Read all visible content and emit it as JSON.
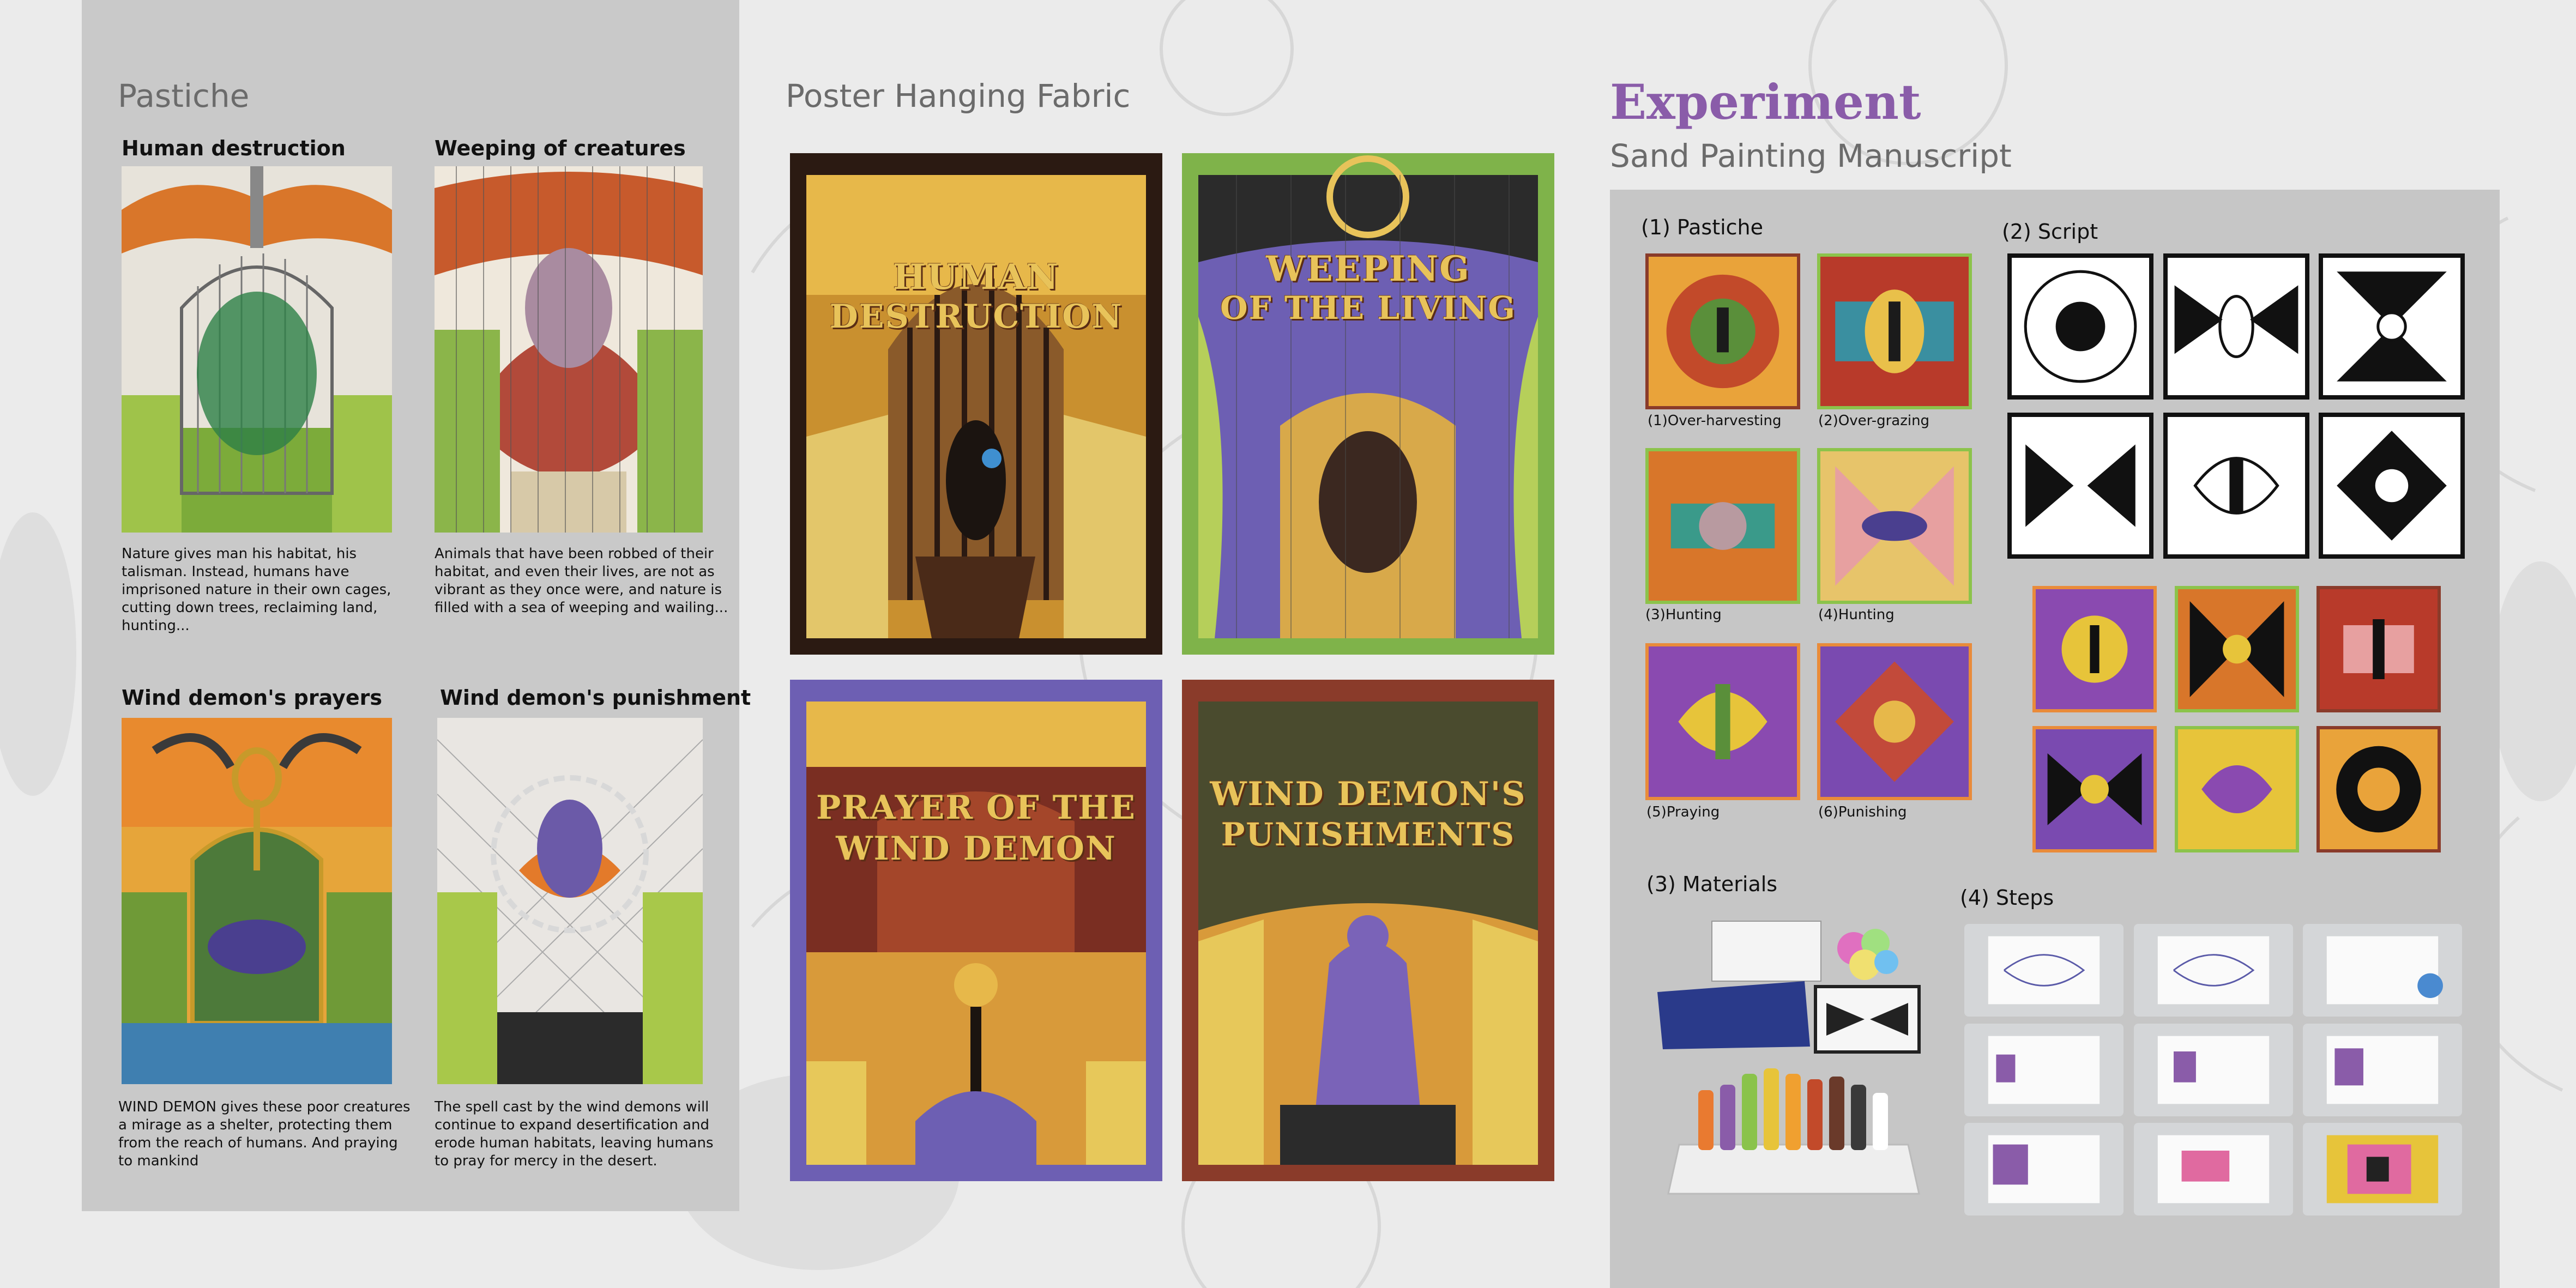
{
  "pastiche": {
    "heading": "Pastiche",
    "items": [
      {
        "title": "Human destruction",
        "desc": "Nature gives man his habitat, his talisman. Instead, humans have imprisoned nature in their own cages, cutting down trees, reclaiming land, hunting..."
      },
      {
        "title": "Weeping of creatures",
        "desc": "Animals that have been robbed of their habitat, and even their lives, are not as vibrant as they once were, and nature is filled with a sea of weeping and wailing..."
      },
      {
        "title": "Wind demon's prayers",
        "desc": "WIND DEMON gives these poor creatures a mirage as a shelter, protecting them from the reach of humans. And praying to mankind"
      },
      {
        "title": "Wind demon's punishment",
        "desc": "The spell cast by the wind demons will continue to expand desertification and erode human habitats, leaving humans to pray for mercy in the desert."
      }
    ]
  },
  "posters": {
    "heading": "Poster Hanging Fabric",
    "items": [
      {
        "title_line1": "HUMAN",
        "title_line2": "DESTRUCTION"
      },
      {
        "title_line1": "WEEPING",
        "title_line2": "OF THE LIVING"
      },
      {
        "title_line1": "PRAYER OF THE",
        "title_line2": "WIND DEMON"
      },
      {
        "title_line1": "WIND DEMON'S",
        "title_line2": "PUNISHMENTS"
      }
    ]
  },
  "experiment": {
    "title": "Experiment",
    "subtitle": "Sand Painting Manuscript",
    "sections": {
      "pastiche": "(1) Pastiche",
      "script": "(2) Script",
      "materials": "(3) Materials",
      "steps": "(4) Steps"
    },
    "tile_captions": [
      "(1)Over-harvesting",
      "(2)Over-grazing",
      "(3)Hunting",
      "(4)Hunting",
      "(5)Praying",
      "(6)Punishing"
    ]
  },
  "colors": {
    "accent_purple": "#8a5ca9",
    "panel_left": "#c9c9c9",
    "panel_right": "#c6c6c6",
    "poster_gold": "#e8c35a"
  }
}
